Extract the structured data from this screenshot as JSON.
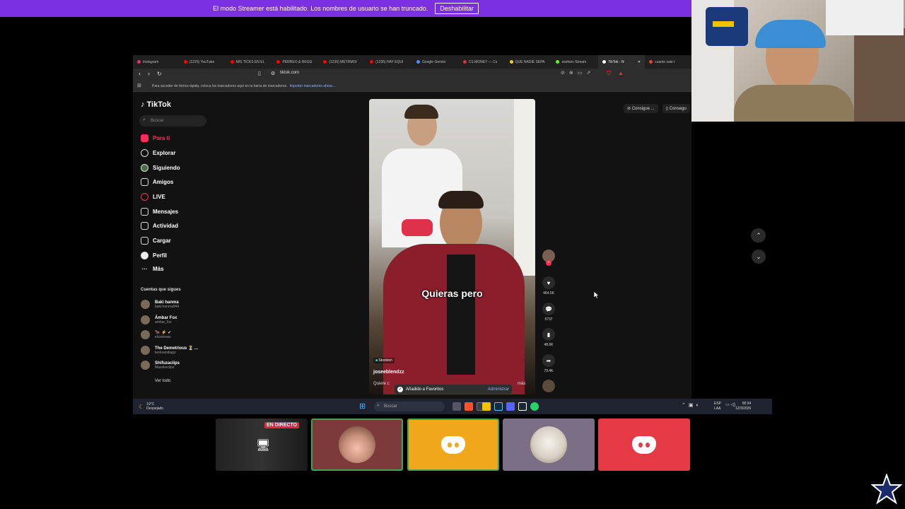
{
  "banner": {
    "message": "El modo Streamer está habilitado. Los nombres de usuario se han truncado.",
    "button": "Deshabilitar"
  },
  "browser": {
    "tabs": [
      {
        "label": "Instagram",
        "color": "#e1306c"
      },
      {
        "label": "(1225) YouTube",
        "color": "#ff0000"
      },
      {
        "label": "MIS TICKS EN EL",
        "color": "#ff0000"
      },
      {
        "label": "PERREO & REGG",
        "color": "#ff0000"
      },
      {
        "label": "(1235) METRMOI",
        "color": "#ff0000"
      },
      {
        "label": "(1235) HAY EQUI",
        "color": "#ff0000"
      },
      {
        "label": "Google Gemini",
        "color": "#4c8df6"
      },
      {
        "label": "CS.MONEY — Cs",
        "color": "#e03030"
      },
      {
        "label": "QUE NADIE SEPA",
        "color": "#f3d000"
      },
      {
        "label": "zeeheis Stream",
        "color": "#53fc18"
      },
      {
        "label": "TikTok - N",
        "color": "#ffffff"
      },
      {
        "label": "cuanto sale t",
        "color": "#ea4335"
      }
    ],
    "url": "tiktok.com",
    "bookmarks_hint": "Para acceder de forma rápida, coloca los marcadores aquí en la barra de marcadores.",
    "bookmarks_link": "Importar marcadores ahora..."
  },
  "tiktok": {
    "logo": "TikTok",
    "search_placeholder": "Buscar",
    "nav": [
      {
        "label": "Para ti",
        "icon": "home-icon"
      },
      {
        "label": "Explorar",
        "icon": "compass-icon"
      },
      {
        "label": "Siguiendo",
        "icon": "following-icon"
      },
      {
        "label": "Amigos",
        "icon": "friends-icon"
      },
      {
        "label": "LIVE",
        "icon": "live-icon"
      },
      {
        "label": "Mensajes",
        "icon": "messages-icon"
      },
      {
        "label": "Actividad",
        "icon": "activity-icon"
      },
      {
        "label": "Cargar",
        "icon": "upload-icon"
      },
      {
        "label": "Perfil",
        "icon": "profile-icon"
      },
      {
        "label": "Más",
        "icon": "more-icon"
      }
    ],
    "following_header": "Cuentas que sigues",
    "following": [
      {
        "name": "Baki hanma",
        "handle": "baki.hanma944"
      },
      {
        "name": "Ámbar Fox",
        "handle": "ambar_fox"
      },
      {
        "name": "🐂 ⚡ ✓",
        "handle": "elcromass"
      },
      {
        "name": "The Demetrious ⏳ ...",
        "handle": "teeksandiago"
      },
      {
        "name": "Shifuzaclips",
        "handle": "Maxokeclips"
      }
    ],
    "see_all": "Ver todo",
    "video": {
      "caption": "Quieras pero",
      "tag": "Stockton",
      "username": "joseeblendzz",
      "description": "Quiere c",
      "more": "más"
    },
    "toast": {
      "text": "Añadido a Favoritos",
      "link": "Administrar"
    },
    "actions": {
      "likes": "464.5K",
      "comments": "5737",
      "saves": "48.6K",
      "shares": "79.4K"
    },
    "get_buttons": [
      "Consigue ...",
      "Consegu"
    ]
  },
  "taskbar": {
    "temp": "19°C",
    "weather": "Despejado",
    "search_placeholder": "Buscar",
    "lang": "ESP",
    "lang_sub": "LAA",
    "time": "00:34",
    "date": "12/3/2026"
  },
  "call": {
    "live_badge": "EN DIRECTO",
    "tile_colors": [
      "#7c3a3a",
      "#f0a71a",
      "#7a6f84",
      "#e53945"
    ]
  }
}
